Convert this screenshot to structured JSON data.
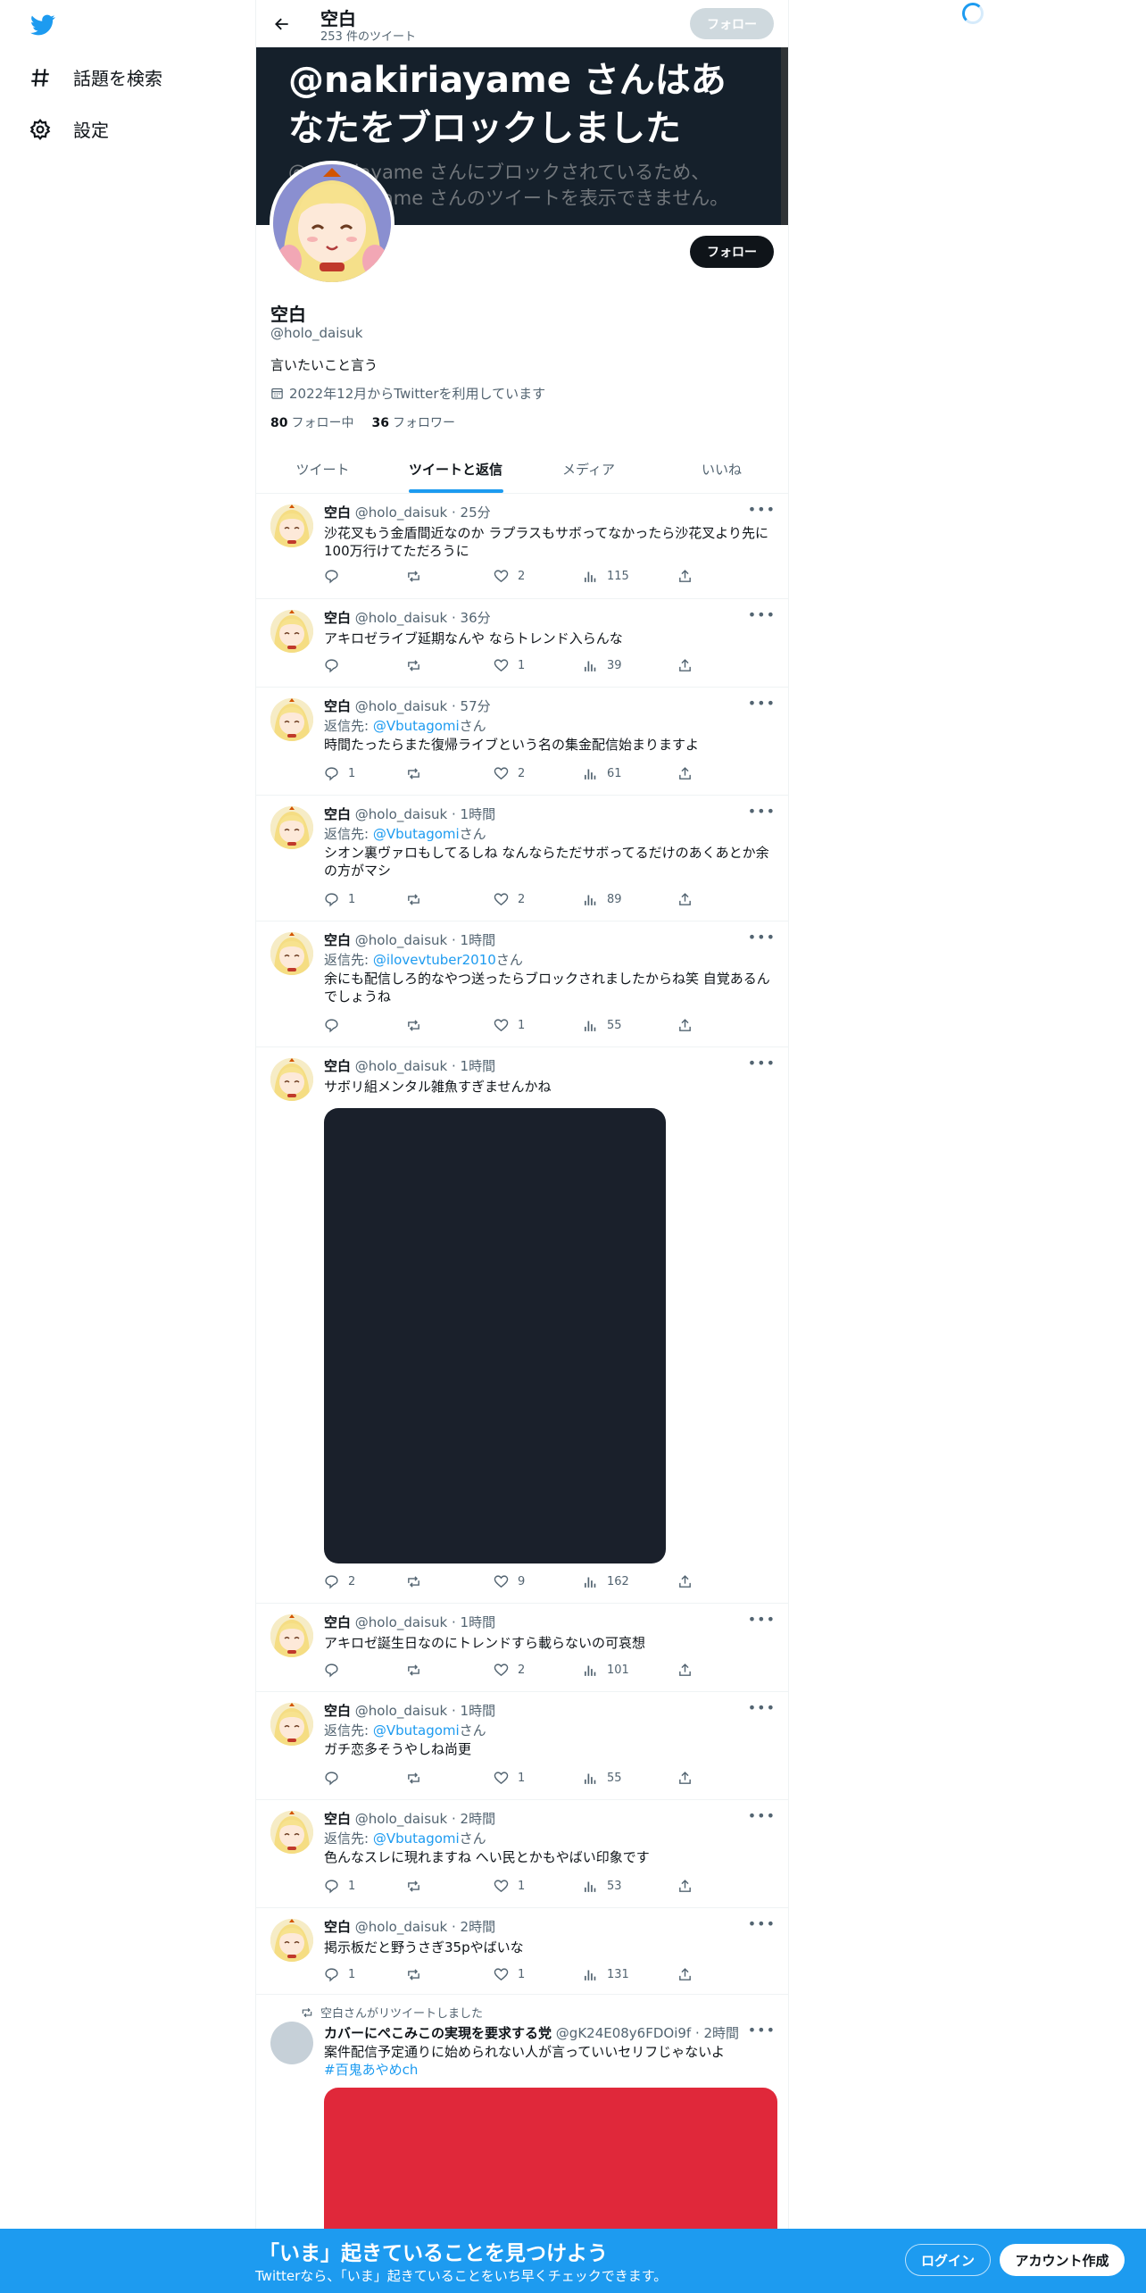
{
  "nav": {
    "explore_label": "話題を検索",
    "settings_label": "設定"
  },
  "header": {
    "title": "空白",
    "tweet_count": "253 件のツイート",
    "follow_label": "フォロー"
  },
  "banner": {
    "title": "@nakiriayame さんはあなたをブロックしました",
    "description": "@nakiriayame さんにブロックされているため、@nakiriayame さんのツイートを表示できません。"
  },
  "profile": {
    "name": "空白",
    "handle": "@holo_daisuk",
    "bio": "言いたいこと言う",
    "joined": "2022年12月からTwitterを利用しています",
    "following_count": "80",
    "following_label": "フォロー中",
    "followers_count": "36",
    "followers_label": "フォロワー",
    "follow_label": "フォロー"
  },
  "tabs": [
    "ツイート",
    "ツイートと返信",
    "メディア",
    "いいね"
  ],
  "tweets": [
    {
      "name": "空白",
      "meta": "@holo_daisuk · 25分",
      "reply_prefix": "",
      "reply_to": "",
      "reply_suffix": "",
      "text": "沙花叉もう金盾間近なのか ラプラスもサボってなかったら沙花叉より先に100万行けてただろうに",
      "replies": "",
      "retweets": "",
      "likes": "2",
      "views": "115"
    },
    {
      "name": "空白",
      "meta": "@holo_daisuk · 36分",
      "reply_prefix": "",
      "reply_to": "",
      "reply_suffix": "",
      "text": "アキロゼライブ延期なんや ならトレンド入らんな",
      "replies": "",
      "retweets": "",
      "likes": "1",
      "views": "39"
    },
    {
      "name": "空白",
      "meta": "@holo_daisuk · 57分",
      "reply_prefix": "返信先: ",
      "reply_to": "@Vbutagomi",
      "reply_suffix": "さん",
      "text": "時間たったらまた復帰ライブという名の集金配信始まりますよ",
      "replies": "1",
      "retweets": "",
      "likes": "2",
      "views": "61"
    },
    {
      "name": "空白",
      "meta": "@holo_daisuk · 1時間",
      "reply_prefix": "返信先: ",
      "reply_to": "@Vbutagomi",
      "reply_suffix": "さん",
      "text": "シオン裏ヴァロもしてるしね なんならただサボってるだけのあくあとか余の方がマシ",
      "replies": "1",
      "retweets": "",
      "likes": "2",
      "views": "89"
    },
    {
      "name": "空白",
      "meta": "@holo_daisuk · 1時間",
      "reply_prefix": "返信先: ",
      "reply_to": "@ilovevtuber2010",
      "reply_suffix": "さん",
      "text": "余にも配信しろ的なやつ送ったらブロックされましたからね笑 自覚あるんでしょうね",
      "replies": "",
      "retweets": "",
      "likes": "1",
      "views": "55"
    },
    {
      "name": "空白",
      "meta": "@holo_daisuk · 1時間",
      "reply_prefix": "",
      "reply_to": "",
      "reply_suffix": "",
      "text": "サボリ組メンタル雑魚すぎませんかね",
      "replies": "2",
      "retweets": "",
      "likes": "9",
      "views": "162"
    },
    {
      "name": "空白",
      "meta": "@holo_daisuk · 1時間",
      "reply_prefix": "",
      "reply_to": "",
      "reply_suffix": "",
      "text": "アキロゼ誕生日なのにトレンドすら載らないの可哀想",
      "replies": "",
      "retweets": "",
      "likes": "2",
      "views": "101"
    },
    {
      "name": "空白",
      "meta": "@holo_daisuk · 1時間",
      "reply_prefix": "返信先: ",
      "reply_to": "@Vbutagomi",
      "reply_suffix": "さん",
      "text": "ガチ恋多そうやしね尚更",
      "replies": "",
      "retweets": "",
      "likes": "1",
      "views": "55"
    },
    {
      "name": "空白",
      "meta": "@holo_daisuk · 2時間",
      "reply_prefix": "返信先: ",
      "reply_to": "@Vbutagomi",
      "reply_suffix": "さん",
      "text": "色んなスレに現れますね へい民とかもやばい印象です",
      "replies": "1",
      "retweets": "",
      "likes": "1",
      "views": "53"
    },
    {
      "name": "空白",
      "meta": "@holo_daisuk · 2時間",
      "reply_prefix": "",
      "reply_to": "",
      "reply_suffix": "",
      "text": "掲示板だと野うさぎ35pやばいな",
      "replies": "1",
      "retweets": "",
      "likes": "1",
      "views": "131"
    }
  ],
  "retweet": {
    "label": "空白さんがリツイートしました",
    "name": "カバーにぺこみこの実現を要求する党",
    "meta": "@gK24E08y6FDOi9f · 2時間",
    "text": "案件配信予定通りに始められない人が言っていいセリフじゃないよ",
    "hashtag": "#百鬼あやめch"
  },
  "bottom_bar": {
    "title": "「いま」起きていることを見つけよう",
    "subtitle": "Twitterなら、「いま」起きていることをいち早くチェックできます。",
    "login_label": "ログイン",
    "signup_label": "アカウント作成"
  },
  "colors": {
    "accent": "#1d9bf0",
    "banner_bg": "#15202b",
    "media_dark": "#1a202b",
    "media_red": "#e0283a"
  }
}
